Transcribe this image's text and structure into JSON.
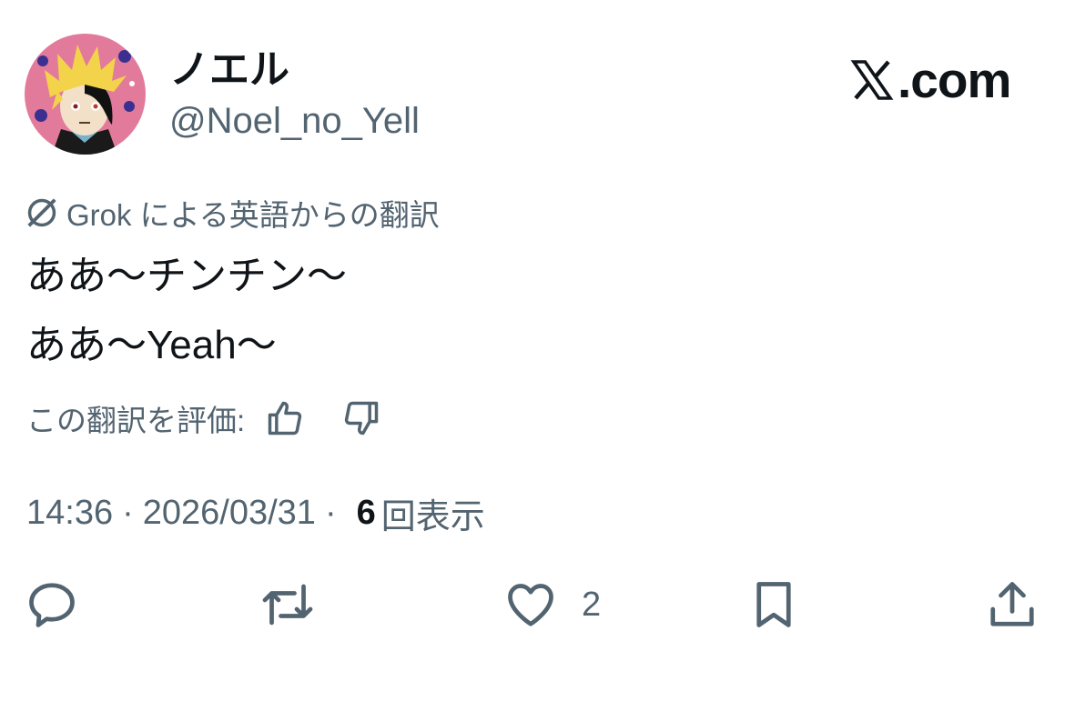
{
  "user": {
    "display_name": "ノエル",
    "handle": "@Noel_no_Yell",
    "avatar_icon": "avatar-image"
  },
  "brand": {
    "text": ".com",
    "icon": "x-logo-icon"
  },
  "translation": {
    "icon": "grok-icon",
    "note": "Grok による英語からの翻訳"
  },
  "tweet": {
    "lines": [
      "ああ〜チンチン〜",
      "ああ〜Yeah〜"
    ]
  },
  "rating": {
    "label": "この翻訳を評価:",
    "up_icon": "thumbs-up-icon",
    "down_icon": "thumbs-down-icon"
  },
  "meta": {
    "time": "14:36",
    "separator": "·",
    "date": "2026/03/31",
    "views_count": "6",
    "views_label": "回表示"
  },
  "actions": {
    "reply_icon": "reply-icon",
    "retweet_icon": "retweet-icon",
    "like_icon": "heart-icon",
    "like_count": "2",
    "bookmark_icon": "bookmark-icon",
    "share_icon": "share-icon"
  },
  "colors": {
    "text_primary": "#0f1419",
    "text_secondary": "#536471",
    "icon_gray": "#536471"
  }
}
